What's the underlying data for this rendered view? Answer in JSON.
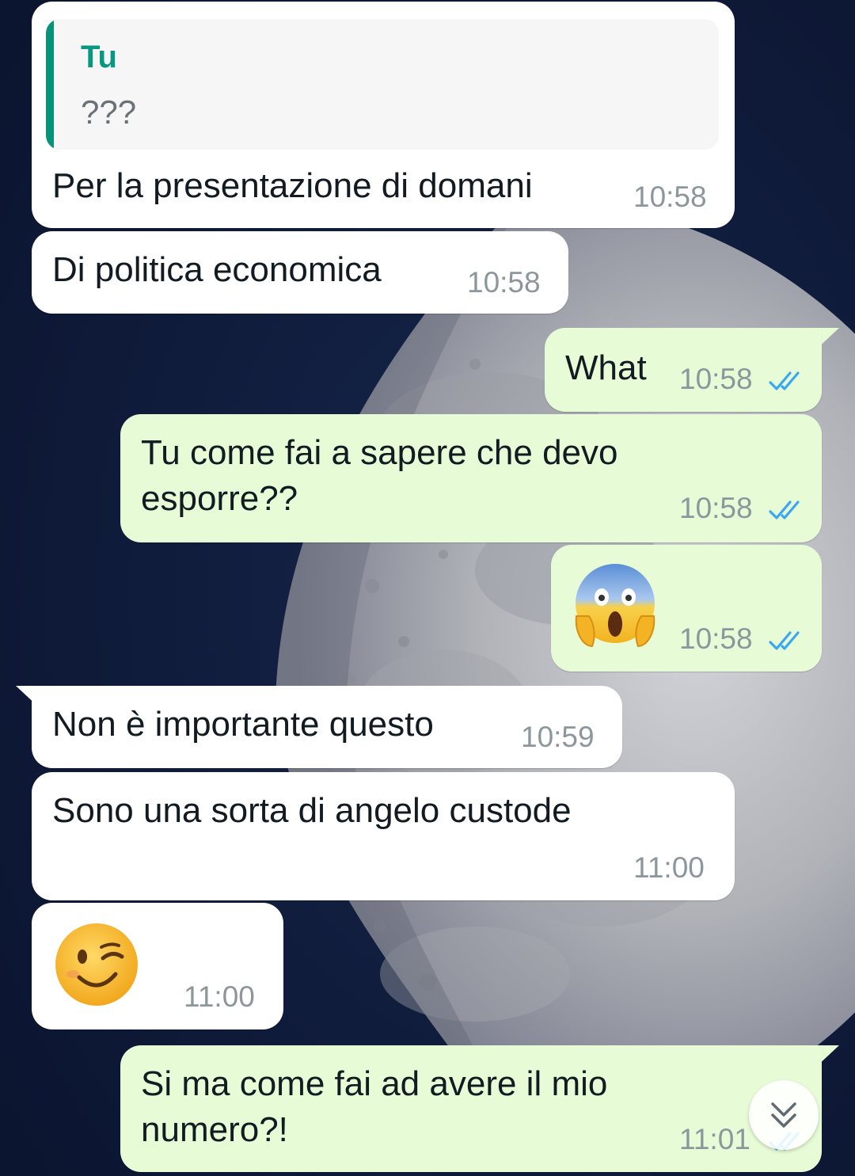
{
  "colors": {
    "incoming_bubble": "#ffffff",
    "outgoing_bubble": "#e7fcd6",
    "read_ticks": "#3aa8f0",
    "quote_accent": "#06937a",
    "timestamp": "#8b979d"
  },
  "messages": [
    {
      "direction": "incoming",
      "quote": {
        "author": "Tu",
        "text": "???"
      },
      "text": "Per la presentazione di domani",
      "time": "10:58"
    },
    {
      "direction": "incoming",
      "text": "Di politica economica",
      "time": "10:58"
    },
    {
      "direction": "outgoing",
      "text": "What",
      "time": "10:58",
      "status": "read"
    },
    {
      "direction": "outgoing",
      "text_lines": [
        "Tu come fai a sapere che devo",
        "esporre??"
      ],
      "time": "10:58",
      "status": "read"
    },
    {
      "direction": "outgoing",
      "emoji": "face-screaming-in-fear",
      "time": "10:58",
      "status": "read"
    },
    {
      "direction": "incoming",
      "text": "Non è importante questo",
      "time": "10:59"
    },
    {
      "direction": "incoming",
      "text": "Sono una sorta di angelo custode",
      "time": "11:00"
    },
    {
      "direction": "incoming",
      "emoji": "winking-face",
      "time": "11:00"
    },
    {
      "direction": "outgoing",
      "text_lines": [
        "Si ma come fai ad avere il mio",
        "numero?!"
      ],
      "time": "11:01",
      "status": "read"
    }
  ],
  "scroll_button": {
    "icon": "double-chevron-down-icon"
  }
}
